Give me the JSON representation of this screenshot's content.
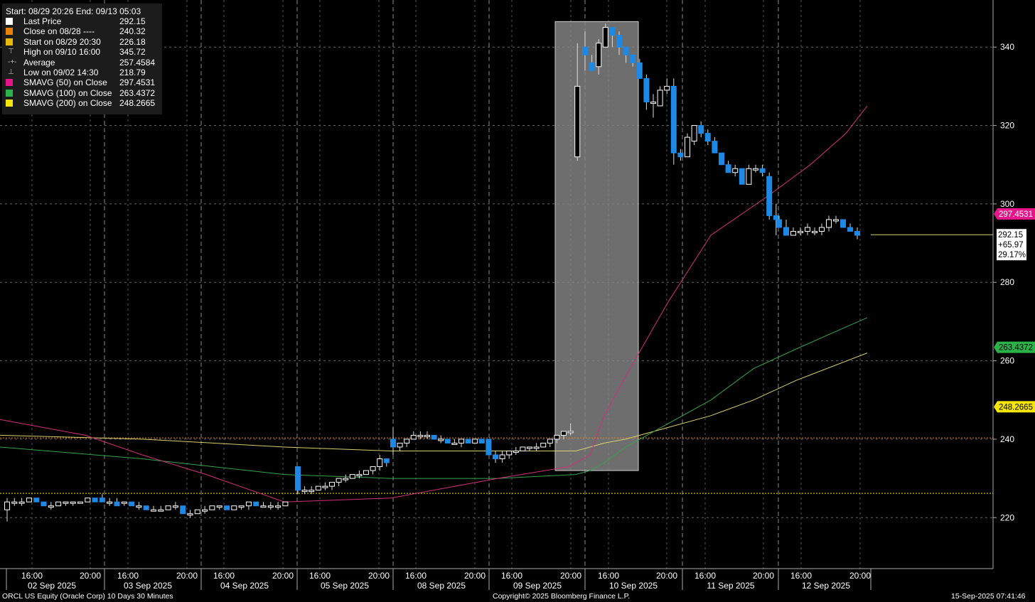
{
  "legend": {
    "header": "Start: 08/29 20:26 End: 09/13 05:03",
    "items": [
      {
        "label": "Last Price",
        "value": "292.15",
        "color": "#ffffff",
        "swatch": "box"
      },
      {
        "label": "Close on 08/28 ----",
        "value": "240.32",
        "color": "#e8820c",
        "swatch": "box"
      },
      {
        "label": "Start on 08/29 20:30",
        "value": "226.18",
        "color": "#e8b80c",
        "swatch": "box"
      },
      {
        "label": "High on 09/10 16:00",
        "value": "345.72",
        "color": "#bbbbbb",
        "swatch": "high-marker"
      },
      {
        "label": "Average",
        "value": "257.4584",
        "color": "#bbbbbb",
        "swatch": "average-marker"
      },
      {
        "label": "Low on 09/02 14:30",
        "value": "218.79",
        "color": "#bbbbbb",
        "swatch": "low-marker"
      },
      {
        "label": "SMAVG (50)  on Close",
        "value": "297.4531",
        "color": "#e6168a",
        "swatch": "box"
      },
      {
        "label": "SMAVG (100)  on Close",
        "value": "263.4372",
        "color": "#2bb34a",
        "swatch": "box"
      },
      {
        "label": "SMAVG (200)  on Close",
        "value": "248.2665",
        "color": "#f5e50a",
        "swatch": "box"
      }
    ]
  },
  "footer": {
    "left": "ORCL US Equity (Oracle Corp) 10 Days 30 Minutes",
    "center": "Copyright© 2025 Bloomberg Finance L.P.",
    "right": "15-Sep-2025 07:41:46"
  },
  "chart_data": {
    "type": "candlestick",
    "ylim": [
      207,
      352
    ],
    "y_ticks": [
      220,
      240,
      260,
      280,
      300,
      320,
      340
    ],
    "days": [
      {
        "label": "02 Sep 2025",
        "times": [
          "16:00",
          "20:00"
        ]
      },
      {
        "label": "03 Sep 2025",
        "times": [
          "16:00",
          "20:00"
        ]
      },
      {
        "label": "04 Sep 2025",
        "times": [
          "16:00",
          "20:00"
        ]
      },
      {
        "label": "05 Sep 2025",
        "times": [
          "16:00",
          "20:00"
        ]
      },
      {
        "label": "08 Sep 2025",
        "times": [
          "16:00",
          "20:00"
        ]
      },
      {
        "label": "09 Sep 2025",
        "times": [
          "16:00",
          "20:00"
        ]
      },
      {
        "label": "10 Sep 2025",
        "times": [
          "16:00",
          "20:00"
        ]
      },
      {
        "label": "11 Sep 2025",
        "times": [
          "16:00",
          "20:00"
        ]
      },
      {
        "label": "12 Sep 2025",
        "times": [
          "16:00",
          "20:00"
        ]
      }
    ],
    "candles": [
      [
        222,
        225,
        219,
        224
      ],
      [
        224,
        225,
        223,
        224
      ],
      [
        224,
        225,
        223,
        224
      ],
      [
        224,
        225,
        224,
        225
      ],
      [
        225,
        225,
        224,
        224
      ],
      [
        224,
        224,
        223,
        223
      ],
      [
        223,
        224,
        222,
        223
      ],
      [
        223,
        224,
        223,
        224
      ],
      [
        224,
        224,
        223,
        224
      ],
      [
        224,
        224,
        223,
        224
      ],
      [
        224,
        224,
        224,
        224
      ],
      [
        224,
        225,
        224,
        225
      ],
      [
        225,
        225,
        224,
        224
      ],
      [
        225,
        226,
        224,
        224
      ],
      [
        224,
        225,
        223,
        224
      ],
      [
        224,
        225,
        223,
        223
      ],
      [
        224,
        224,
        223,
        224
      ],
      [
        224,
        224,
        223,
        223
      ],
      [
        223,
        224,
        222,
        223
      ],
      [
        223,
        223,
        222,
        222
      ],
      [
        222,
        223,
        222,
        222
      ],
      [
        222,
        223,
        222,
        222
      ],
      [
        222,
        223,
        222,
        223
      ],
      [
        223,
        224,
        222,
        223
      ],
      [
        223,
        223,
        221,
        221
      ],
      [
        221,
        222,
        220,
        221
      ],
      [
        221,
        222,
        221,
        222
      ],
      [
        222,
        223,
        221,
        222
      ],
      [
        222,
        223,
        222,
        223
      ],
      [
        223,
        223,
        222,
        223
      ],
      [
        223,
        223,
        222,
        222
      ],
      [
        222,
        223,
        222,
        223
      ],
      [
        223,
        223,
        222,
        223
      ],
      [
        223,
        224,
        222,
        224
      ],
      [
        224,
        224,
        223,
        223
      ],
      [
        223,
        224,
        223,
        223
      ],
      [
        223,
        224,
        222,
        223
      ],
      [
        223,
        224,
        222,
        223
      ],
      [
        223,
        224,
        223,
        224
      ],
      [
        233,
        233,
        226,
        227
      ],
      [
        227,
        228,
        226,
        227
      ],
      [
        227,
        228,
        226,
        227
      ],
      [
        227,
        228,
        227,
        228
      ],
      [
        228,
        229,
        227,
        228
      ],
      [
        228,
        229,
        227,
        229
      ],
      [
        229,
        230,
        228,
        230
      ],
      [
        230,
        231,
        229,
        230
      ],
      [
        230,
        231,
        230,
        231
      ],
      [
        231,
        232,
        230,
        231
      ],
      [
        231,
        232,
        231,
        232
      ],
      [
        232,
        233,
        231,
        233
      ],
      [
        233,
        236,
        232,
        235
      ],
      [
        235,
        235,
        233,
        234
      ],
      [
        240,
        243,
        236,
        238
      ],
      [
        238,
        239,
        237,
        239
      ],
      [
        239,
        240,
        238,
        240
      ],
      [
        240,
        242,
        240,
        241
      ],
      [
        241,
        242,
        240,
        241
      ],
      [
        241,
        242,
        240,
        241
      ],
      [
        241,
        241,
        240,
        240
      ],
      [
        240,
        241,
        239,
        240
      ],
      [
        240,
        240,
        239,
        239
      ],
      [
        239,
        240,
        239,
        239
      ],
      [
        239,
        240,
        238,
        240
      ],
      [
        240,
        240,
        239,
        239
      ],
      [
        239,
        240,
        239,
        240
      ],
      [
        240,
        240,
        239,
        239
      ],
      [
        240,
        240,
        237,
        236
      ],
      [
        236,
        237,
        234,
        235
      ],
      [
        235,
        237,
        234,
        236
      ],
      [
        236,
        237,
        235,
        237
      ],
      [
        237,
        238,
        236,
        237
      ],
      [
        237,
        238,
        237,
        238
      ],
      [
        238,
        238,
        237,
        238
      ],
      [
        238,
        239,
        237,
        238
      ],
      [
        238,
        239,
        238,
        239
      ],
      [
        239,
        240,
        238,
        240
      ],
      [
        240,
        241,
        239,
        241
      ],
      [
        241,
        242,
        240,
        242
      ],
      [
        242,
        244,
        241,
        242
      ],
      [
        312,
        341,
        311,
        330
      ],
      [
        340,
        344,
        334,
        338
      ],
      [
        336,
        338,
        334,
        334
      ],
      [
        335,
        342,
        333,
        341
      ],
      [
        340,
        346,
        340,
        345
      ],
      [
        345,
        345,
        340,
        343
      ],
      [
        343,
        344,
        338,
        340
      ],
      [
        340,
        340,
        336,
        338
      ],
      [
        338,
        338,
        335,
        336
      ],
      [
        336,
        337,
        332,
        332
      ],
      [
        332,
        333,
        324,
        326
      ],
      [
        326,
        328,
        322,
        326
      ],
      [
        325,
        330,
        325,
        329
      ],
      [
        329,
        332,
        328,
        330
      ],
      [
        330,
        332,
        310,
        313
      ],
      [
        313,
        314,
        311,
        312
      ],
      [
        312,
        318,
        312,
        317
      ],
      [
        316,
        320,
        315,
        320
      ],
      [
        320,
        321,
        317,
        318
      ],
      [
        318,
        319,
        315,
        316
      ],
      [
        316,
        317,
        313,
        313
      ],
      [
        313,
        313,
        310,
        310
      ],
      [
        310,
        311,
        308,
        308
      ],
      [
        308,
        310,
        307,
        309
      ],
      [
        309,
        309,
        305,
        305
      ],
      [
        305,
        310,
        305,
        309
      ],
      [
        309,
        310,
        308,
        309
      ],
      [
        309,
        310,
        307,
        308
      ],
      [
        307,
        308,
        296,
        297
      ],
      [
        297,
        300,
        292,
        296
      ],
      [
        296,
        297,
        294,
        294
      ],
      [
        294,
        296,
        292,
        292
      ],
      [
        292,
        294,
        292,
        293
      ],
      [
        293,
        294,
        292,
        293
      ],
      [
        293,
        295,
        292,
        294
      ],
      [
        293,
        294,
        292,
        293
      ],
      [
        293,
        295,
        292,
        294
      ],
      [
        294,
        297,
        293,
        296
      ],
      [
        296,
        297,
        295,
        296
      ],
      [
        296,
        296,
        294,
        294
      ],
      [
        294,
        295,
        293,
        293
      ],
      [
        293,
        294,
        291,
        292
      ]
    ],
    "sma50": [
      [
        0,
        245
      ],
      [
        120,
        241
      ],
      [
        200,
        236
      ],
      [
        290,
        231
      ],
      [
        400,
        224
      ],
      [
        550,
        225
      ],
      [
        700,
        230
      ],
      [
        800,
        233
      ],
      [
        830,
        236
      ],
      [
        850,
        246
      ],
      [
        880,
        256
      ],
      [
        940,
        275
      ],
      [
        1000,
        292
      ],
      [
        1080,
        302
      ],
      [
        1140,
        310
      ],
      [
        1190,
        318
      ],
      [
        1220,
        325
      ]
    ],
    "sma100": [
      [
        0,
        238
      ],
      [
        200,
        235
      ],
      [
        300,
        233
      ],
      [
        400,
        231
      ],
      [
        550,
        230
      ],
      [
        700,
        230
      ],
      [
        810,
        231
      ],
      [
        830,
        232
      ],
      [
        850,
        234
      ],
      [
        880,
        238
      ],
      [
        940,
        244
      ],
      [
        1000,
        250
      ],
      [
        1060,
        258
      ],
      [
        1120,
        263
      ],
      [
        1220,
        271
      ]
    ],
    "sma200": [
      [
        0,
        241
      ],
      [
        200,
        240
      ],
      [
        300,
        239
      ],
      [
        400,
        238
      ],
      [
        550,
        237
      ],
      [
        700,
        237
      ],
      [
        810,
        237
      ],
      [
        830,
        238
      ],
      [
        850,
        239
      ],
      [
        880,
        240
      ],
      [
        940,
        243
      ],
      [
        1000,
        246
      ],
      [
        1060,
        250
      ],
      [
        1120,
        255
      ],
      [
        1220,
        262
      ]
    ],
    "highlight": [
      781,
      898
    ],
    "close_on_08_28": 240.32,
    "start_price": 226.18,
    "right_labels": [
      {
        "value": 297.4531,
        "text": "297.4531",
        "color": "#e6168a"
      },
      {
        "value": 263.4372,
        "text": "263.4372",
        "color": "#2bb34a"
      },
      {
        "value": 248.2665,
        "text": "248.2665",
        "color": "#f5e50a"
      }
    ],
    "last_box": {
      "price": 292.15,
      "lines": [
        "292.15",
        "+65.97",
        "29.17%"
      ]
    }
  }
}
